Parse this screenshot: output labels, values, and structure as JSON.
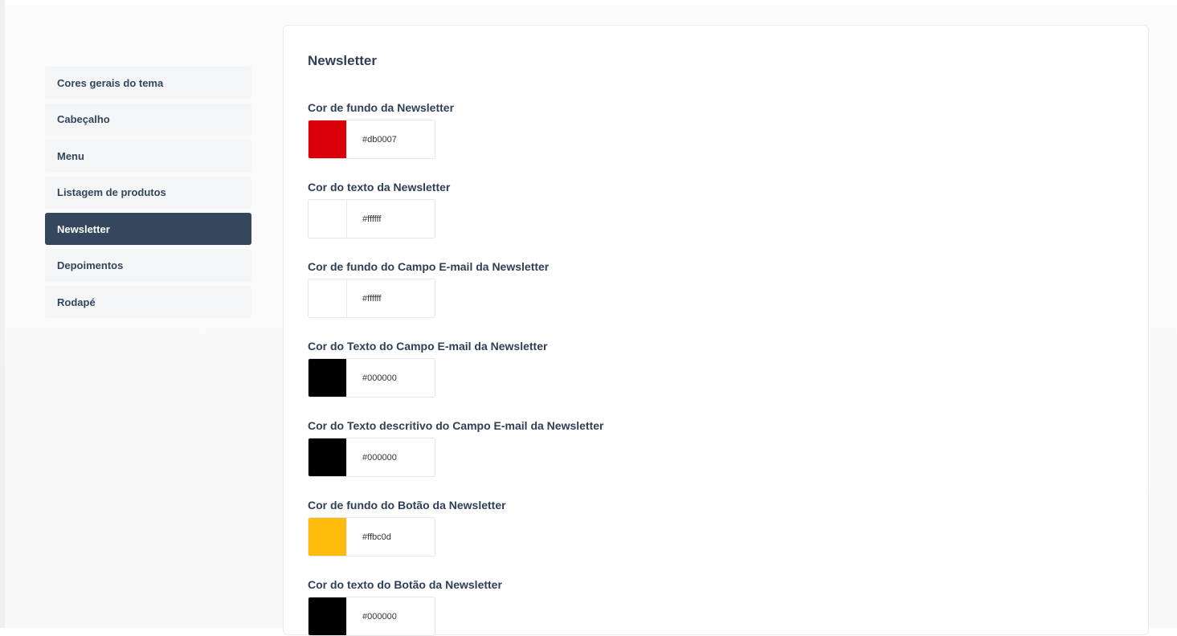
{
  "sidebar": {
    "items": [
      {
        "label": "Cores gerais do tema",
        "active": false
      },
      {
        "label": "Cabeçalho",
        "active": false
      },
      {
        "label": "Menu",
        "active": false
      },
      {
        "label": "Listagem de produtos",
        "active": false
      },
      {
        "label": "Newsletter",
        "active": true
      },
      {
        "label": "Depoimentos",
        "active": false
      },
      {
        "label": "Rodapé",
        "active": false
      }
    ]
  },
  "panel": {
    "title": "Newsletter",
    "fields": [
      {
        "label": "Cor de fundo da Newsletter",
        "value": "#db0007",
        "color": "#db0007"
      },
      {
        "label": "Cor do texto da Newsletter",
        "value": "#ffffff",
        "color": "#ffffff"
      },
      {
        "label": "Cor de fundo do Campo E-mail da Newsletter",
        "value": "#ffffff",
        "color": "#ffffff"
      },
      {
        "label": "Cor do Texto do Campo E-mail da Newsletter",
        "value": "#000000",
        "color": "#000000"
      },
      {
        "label": "Cor do Texto descritivo do Campo E-mail da Newsletter",
        "value": "#000000",
        "color": "#000000"
      },
      {
        "label": "Cor de fundo do Botão da Newsletter",
        "value": "#ffbc0d",
        "color": "#ffbc0d"
      },
      {
        "label": "Cor do texto do Botão da Newsletter",
        "value": "#000000",
        "color": "#000000"
      }
    ]
  }
}
